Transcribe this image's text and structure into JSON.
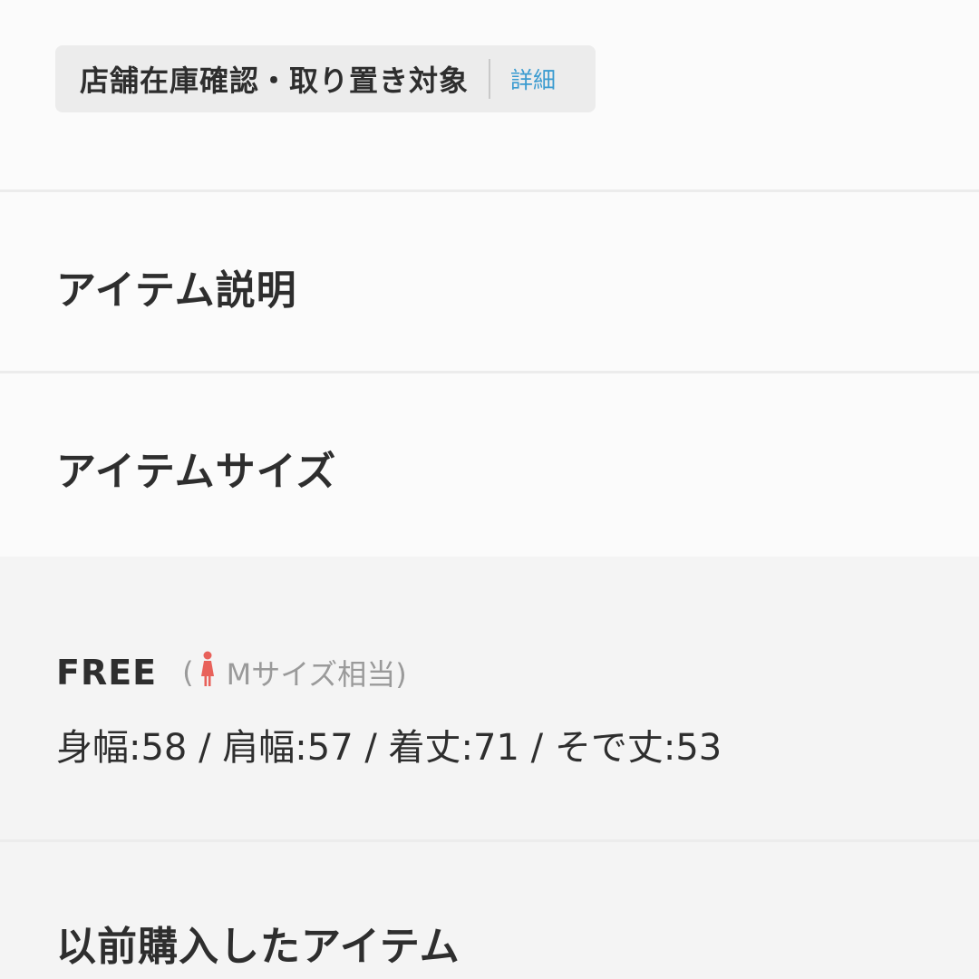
{
  "stock_badge": {
    "label": "店舗在庫確認・取り置き対象",
    "detail_link": "詳細",
    "link_color": "#3a9bd0"
  },
  "sections": {
    "description_heading": "アイテム説明",
    "size_heading": "アイテムサイズ",
    "history_heading": "以前購入したアイテム"
  },
  "size_info": {
    "size_name": "FREE",
    "paren_open": "(",
    "equivalent": "Mサイズ相当)",
    "person_icon": "woman-figure-icon",
    "person_icon_color": "#e8615a",
    "measurements": "身幅:58 / 肩幅:57 / 着丈:71 / そで丈:53"
  }
}
